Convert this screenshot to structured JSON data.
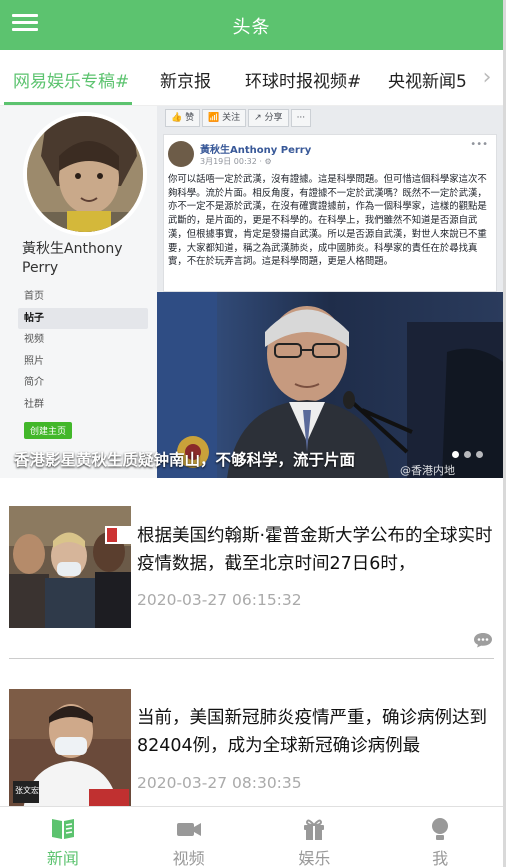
{
  "header": {
    "title": "头条",
    "menu_icon": "hamburger-menu-icon"
  },
  "tabs": [
    {
      "label": "网易娱乐专稿#",
      "active": true
    },
    {
      "label": "新京报",
      "active": false
    },
    {
      "label": "环球时报视频#",
      "active": false
    },
    {
      "label": "央视新闻5",
      "active": false
    }
  ],
  "featured": {
    "caption": "香港影星黄秋生质疑钟南山，不够科学，流于片面",
    "watermark": "@香港内地",
    "profile": {
      "name": "黃秋生Anthony Perry",
      "nav": [
        "首页",
        "帖子",
        "视频",
        "照片",
        "简介",
        "社群"
      ],
      "selected_nav": "帖子",
      "create_button": "创建主页",
      "actions": [
        "👍 赞",
        "📶 关注",
        "↗ 分享",
        "···"
      ]
    },
    "post": {
      "author": "黃秋生Anthony Perry",
      "date": "3月19日 00:32 · ⚙",
      "body": "你可以話唔一定於武漢，沒有證據。這是科學問題。但可惜這個科學家這次不夠科學。流於片面。相反角度，有證據不一定於武漢嗎？既然不一定於武漢，亦不一定不是源於武漢，在沒有確實證據前，作為一個科學家，這樣的觀點是武斷的，是片面的，更是不科學的。在科學上，我們雖然不知道是否源自武漢，但根據事實，肯定是發揚自武漢。所以是否源自武漢，對世人來說已不重要，大家都知道，稱之為武漢肺炎，成中國肺炎。科學家的責任在於尋找真實，不在於玩弄言詞。這是科學問題，更是人格問題。"
    }
  },
  "news": [
    {
      "title": "根据美国约翰斯·霍普金斯大学公布的全球实时疫情数据，截至北京时间27日6时，",
      "time": "2020-03-27 06:15:32"
    },
    {
      "title": "当前，美国新冠肺炎疫情严重，确诊病例达到82404例，成为全球新冠确诊病例最",
      "time": "2020-03-27 08:30:35"
    }
  ],
  "bottom_nav": [
    {
      "label": "新闻",
      "icon": "news-icon",
      "active": true
    },
    {
      "label": "视频",
      "icon": "video-camera-icon",
      "active": false
    },
    {
      "label": "娱乐",
      "icon": "gift-icon",
      "active": false
    },
    {
      "label": "我",
      "icon": "user-icon",
      "active": false
    }
  ],
  "colors": {
    "accent": "#5cc36f",
    "time_text": "#aaaaaa",
    "inactive_nav": "#999999"
  }
}
